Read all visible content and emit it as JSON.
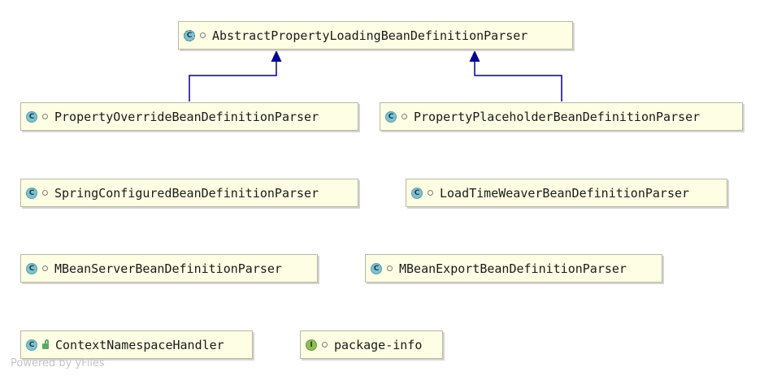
{
  "nodes": [
    {
      "id": "abstract-parser",
      "label": "AbstractPropertyLoadingBeanDefinitionParser",
      "kind": "abstract-class",
      "kind_glyph": "C",
      "visibility": "package-private"
    },
    {
      "id": "override-parser",
      "label": "PropertyOverrideBeanDefinitionParser",
      "kind": "class",
      "kind_glyph": "C",
      "visibility": "package-private"
    },
    {
      "id": "placeholder-parser",
      "label": "PropertyPlaceholderBeanDefinitionParser",
      "kind": "class",
      "kind_glyph": "C",
      "visibility": "package-private"
    },
    {
      "id": "spring-configured-parser",
      "label": "SpringConfiguredBeanDefinitionParser",
      "kind": "class",
      "kind_glyph": "C",
      "visibility": "package-private"
    },
    {
      "id": "ltw-parser",
      "label": "LoadTimeWeaverBeanDefinitionParser",
      "kind": "class",
      "kind_glyph": "C",
      "visibility": "package-private"
    },
    {
      "id": "mbean-server-parser",
      "label": "MBeanServerBeanDefinitionParser",
      "kind": "class",
      "kind_glyph": "C",
      "visibility": "package-private"
    },
    {
      "id": "mbean-export-parser",
      "label": "MBeanExportBeanDefinitionParser",
      "kind": "class",
      "kind_glyph": "C",
      "visibility": "package-private"
    },
    {
      "id": "namespace-handler",
      "label": "ContextNamespaceHandler",
      "kind": "class",
      "kind_glyph": "C",
      "visibility": "public"
    },
    {
      "id": "package-info",
      "label": "package-info",
      "kind": "interface",
      "kind_glyph": "I",
      "visibility": "package-private"
    }
  ],
  "edges": [
    {
      "from": "override-parser",
      "to": "abstract-parser",
      "type": "extends"
    },
    {
      "from": "placeholder-parser",
      "to": "abstract-parser",
      "type": "extends"
    }
  ],
  "colors": {
    "node_fill": "#fefee4",
    "node_border": "#b9b9a4",
    "edge": "#00008b",
    "class_icon": "#7fc1cf",
    "interface_icon": "#8fbc5a"
  },
  "watermark": "Powered by yFiles"
}
